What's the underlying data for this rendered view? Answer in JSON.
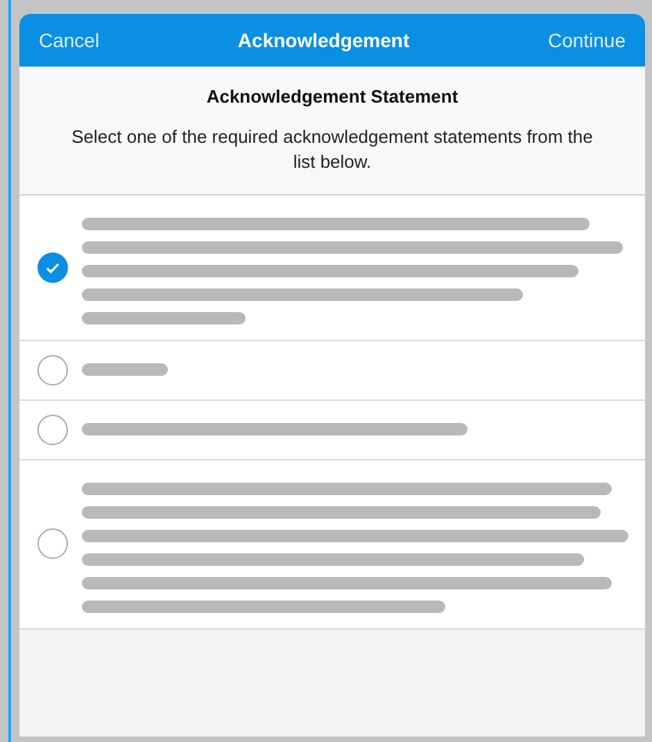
{
  "header": {
    "cancel": "Cancel",
    "title": "Acknowledgement",
    "continue": "Continue"
  },
  "heading": "Acknowledgement Statement",
  "instructions": "Select one of the required acknowledgement statements from the list below.",
  "options": [
    {
      "selected": true,
      "kind": "paragraph"
    },
    {
      "selected": false,
      "kind": "phrase"
    },
    {
      "selected": false,
      "kind": "sentence"
    },
    {
      "selected": false,
      "kind": "long_paragraph"
    }
  ]
}
